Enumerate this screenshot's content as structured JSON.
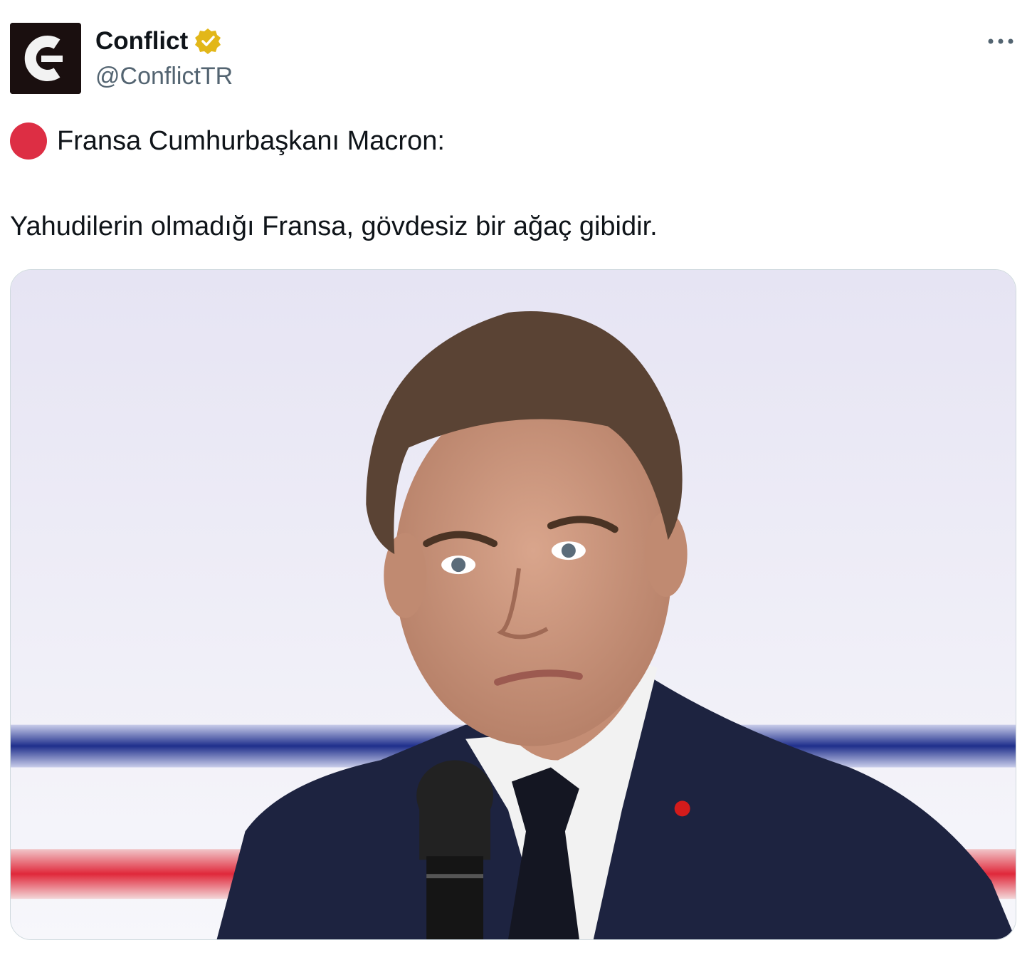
{
  "account": {
    "display_name": "Conflict",
    "handle": "@ConflictTR",
    "verified": true,
    "avatar_icon": "conflict-logo-icon",
    "verified_badge_color": "#e2b719"
  },
  "tweet": {
    "line1_emoji": "red-circle-icon",
    "line1_text": "Fransa Cumhurbaşkanı Macron:",
    "line2_text": "Yahudilerin olmadığı Fransa, gövdesiz bir ağaç gibidir."
  },
  "media": {
    "icon": "photo-of-man-speaking-into-microphone-icon"
  },
  "more_icon": "more-options-icon",
  "colors": {
    "text": "#0f1419",
    "secondary": "#536471",
    "red_circle": "#dd2e44",
    "border": "#cfd9de",
    "flag_blue": "#1f2f8c",
    "flag_red": "#e0283a"
  }
}
